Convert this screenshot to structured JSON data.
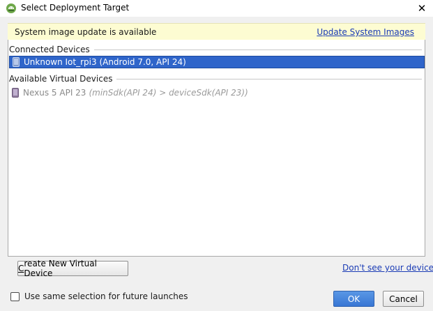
{
  "window": {
    "title": "Select Deployment Target",
    "close_glyph": "✕",
    "app_icon": "android-studio-icon"
  },
  "banner": {
    "message": "System image update is available",
    "link_label": "Update System Images",
    "background": "#fdfcd2",
    "link_color": "#1a3bb5"
  },
  "sections": {
    "connected": {
      "label": "Connected Devices",
      "devices": [
        {
          "name": "Unknown Iot_rpi3 (Android 7.0, API 24)",
          "selected": true,
          "icon": "phone-icon"
        }
      ]
    },
    "virtual": {
      "label": "Available Virtual Devices",
      "devices": [
        {
          "name": "Nexus 5 API 23",
          "detail": "(minSdk(API 24) > deviceSdk(API 23))",
          "selected": false,
          "disabled": true,
          "icon": "phone-icon"
        }
      ]
    }
  },
  "buttons": {
    "create_prefix": "C",
    "create_rest": "reate New Virtual Device",
    "ok": "OK",
    "cancel": "Cancel"
  },
  "help_link": "Don't see your device?",
  "checkbox": {
    "label": "Use same selection for future launches",
    "checked": false
  },
  "colors": {
    "selection": "#2f65ca",
    "ok_button": "#3876d4"
  }
}
